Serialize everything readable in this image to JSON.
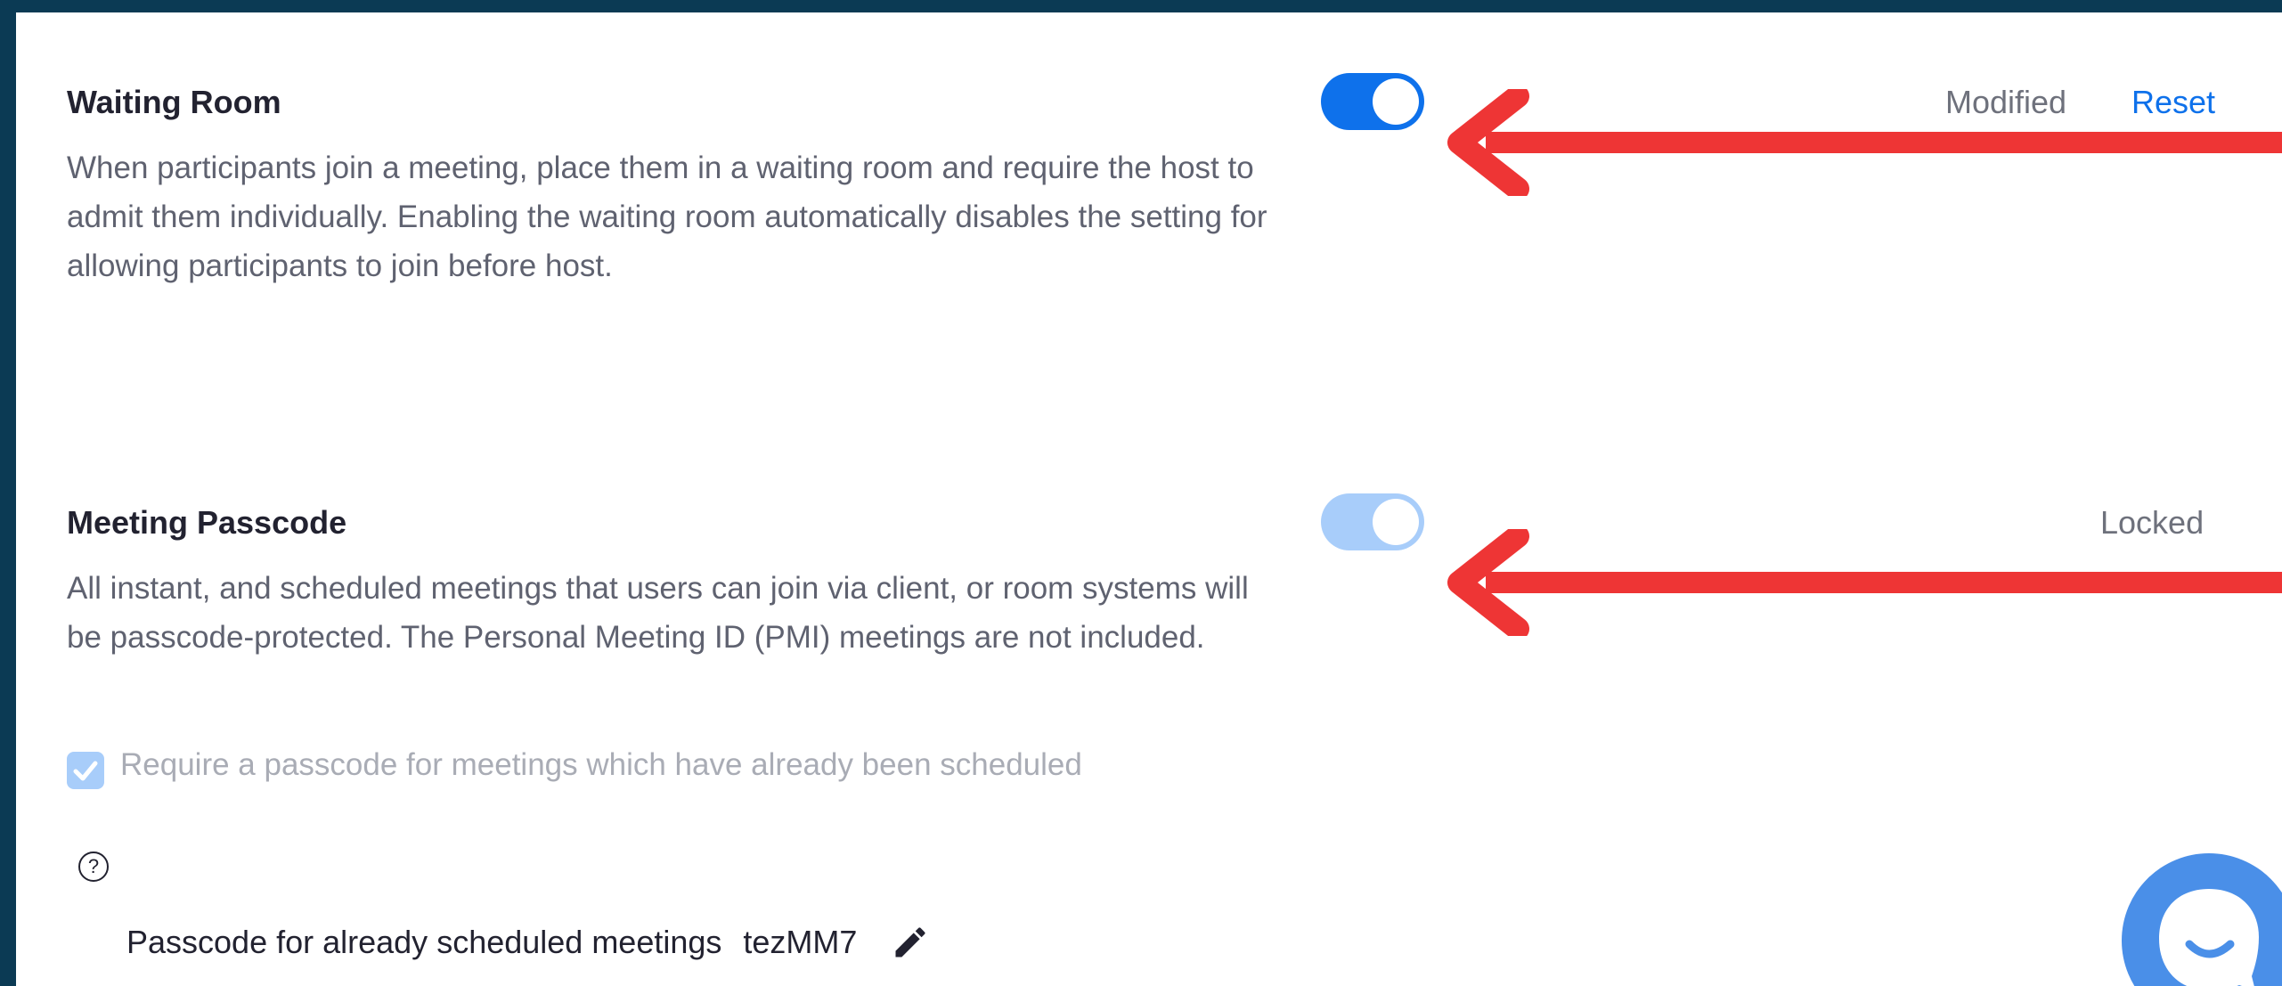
{
  "waiting_room": {
    "title": "Waiting Room",
    "description": "When participants join a meeting, place them in a waiting room and require the host to admit them individually. Enabling the waiting room automatically disables the setting for allowing participants to join before host.",
    "enabled": true,
    "status": "Modified",
    "reset_label": "Reset"
  },
  "meeting_passcode": {
    "title": "Meeting Passcode",
    "description": "All instant, and scheduled meetings that users can join via client, or room systems will be passcode-protected. The Personal Meeting ID (PMI) meetings are not included.",
    "enabled": true,
    "status": "Locked",
    "require_passcode_label": "Require a passcode for meetings which have already been scheduled",
    "require_passcode_checked": true,
    "help_symbol": "?",
    "passcode_label": "Passcode for already scheduled meetings",
    "passcode_value": "tezMM7"
  },
  "icons": {
    "help": "question-circle-icon",
    "edit": "pencil-icon",
    "chat": "chat-bubble-icon",
    "annotation": "red-arrow-icon"
  },
  "colors": {
    "background": "#0b3a54",
    "toggle_on": "#0e71eb",
    "toggle_disabled": "#a8cdfa",
    "link": "#0e71eb",
    "arrow": "#ee3535",
    "chat_button": "#4a8fe8"
  }
}
